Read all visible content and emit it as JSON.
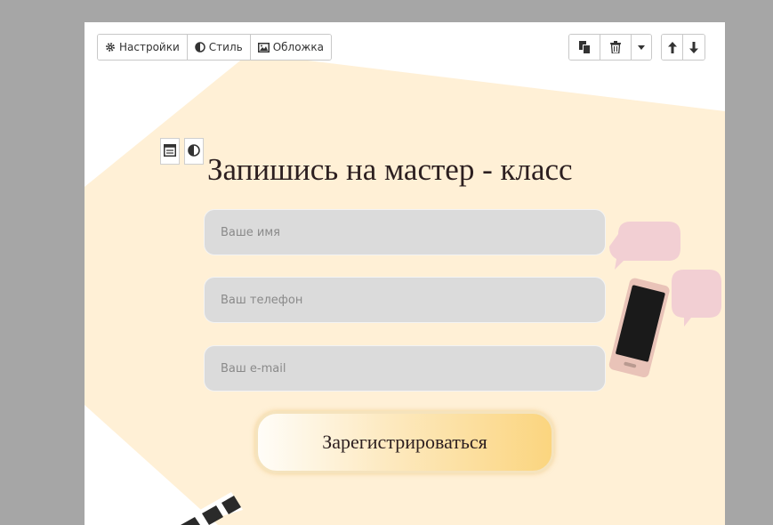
{
  "toolbar": {
    "settings_label": "Настройки",
    "style_label": "Стиль",
    "cover_label": "Обложка"
  },
  "form": {
    "title": "Запишись на мастер - класс",
    "name_placeholder": "Ваше имя",
    "phone_placeholder": "Ваш телефон",
    "email_placeholder": "Ваш e-mail",
    "submit_label": "Зарегистрироваться"
  },
  "colors": {
    "backdrop": "#a6a6a6",
    "canvas": "#ffffff",
    "shape": "#fff0d6",
    "field": "#dbdbdb",
    "button_gradient_end": "#fbd57f"
  },
  "icons": [
    "gear-icon",
    "contrast-icon",
    "image-icon",
    "copy-icon",
    "trash-icon",
    "caret-down-icon",
    "arrow-up-icon",
    "arrow-down-icon",
    "form-icon",
    "phone-illustration",
    "speech-bubble-icon",
    "clapperboard-illustration"
  ]
}
